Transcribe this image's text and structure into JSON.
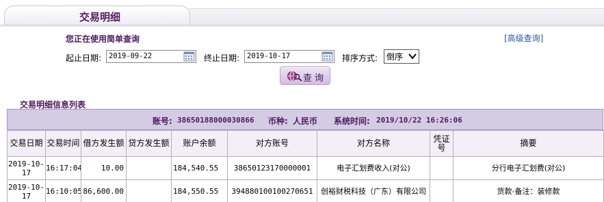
{
  "tab": {
    "title": "交易明细"
  },
  "query": {
    "section_title": "您正在使用简单查询",
    "advanced_link": "[高级查询]",
    "start_label": "起止日期:",
    "start_value": "2019-09-22",
    "end_label": "终止日期:",
    "end_value": "2019-10-17",
    "sort_label": "排序方式:",
    "sort_value": "倒序",
    "button_label": "查询"
  },
  "list": {
    "title": "交易明细信息列表",
    "account_label": "账号:",
    "account_value": "38650188000030866",
    "currency_label": "币种:",
    "currency_value": "人民币",
    "time_label": "系统时间:",
    "time_value": "2019/10/22 16:26:06"
  },
  "table": {
    "headers": [
      "交易日期",
      "交易时间",
      "借方发生额",
      "贷方发生额",
      "账户余额",
      "对方账号",
      "对方名称",
      "凭证号",
      "摘要"
    ],
    "rows": [
      {
        "date": "2019-10-17",
        "time": "16:17:04",
        "debit": "10.00",
        "credit": "",
        "balance": "184,540.55",
        "counter_account": "38650123170000001",
        "counter_name": "电子汇划费收入(对公)",
        "voucher": "",
        "summary": "分行电子汇划费(对公)"
      },
      {
        "date": "2019-10-17",
        "time": "16:10:05",
        "debit": "86,600.00",
        "credit": "",
        "balance": "184,550.55",
        "counter_account": "394880100100270651",
        "counter_name": "创裕财税科技（广东）有限公司",
        "voucher": "",
        "summary": "货款-备注：装修款"
      }
    ]
  }
}
